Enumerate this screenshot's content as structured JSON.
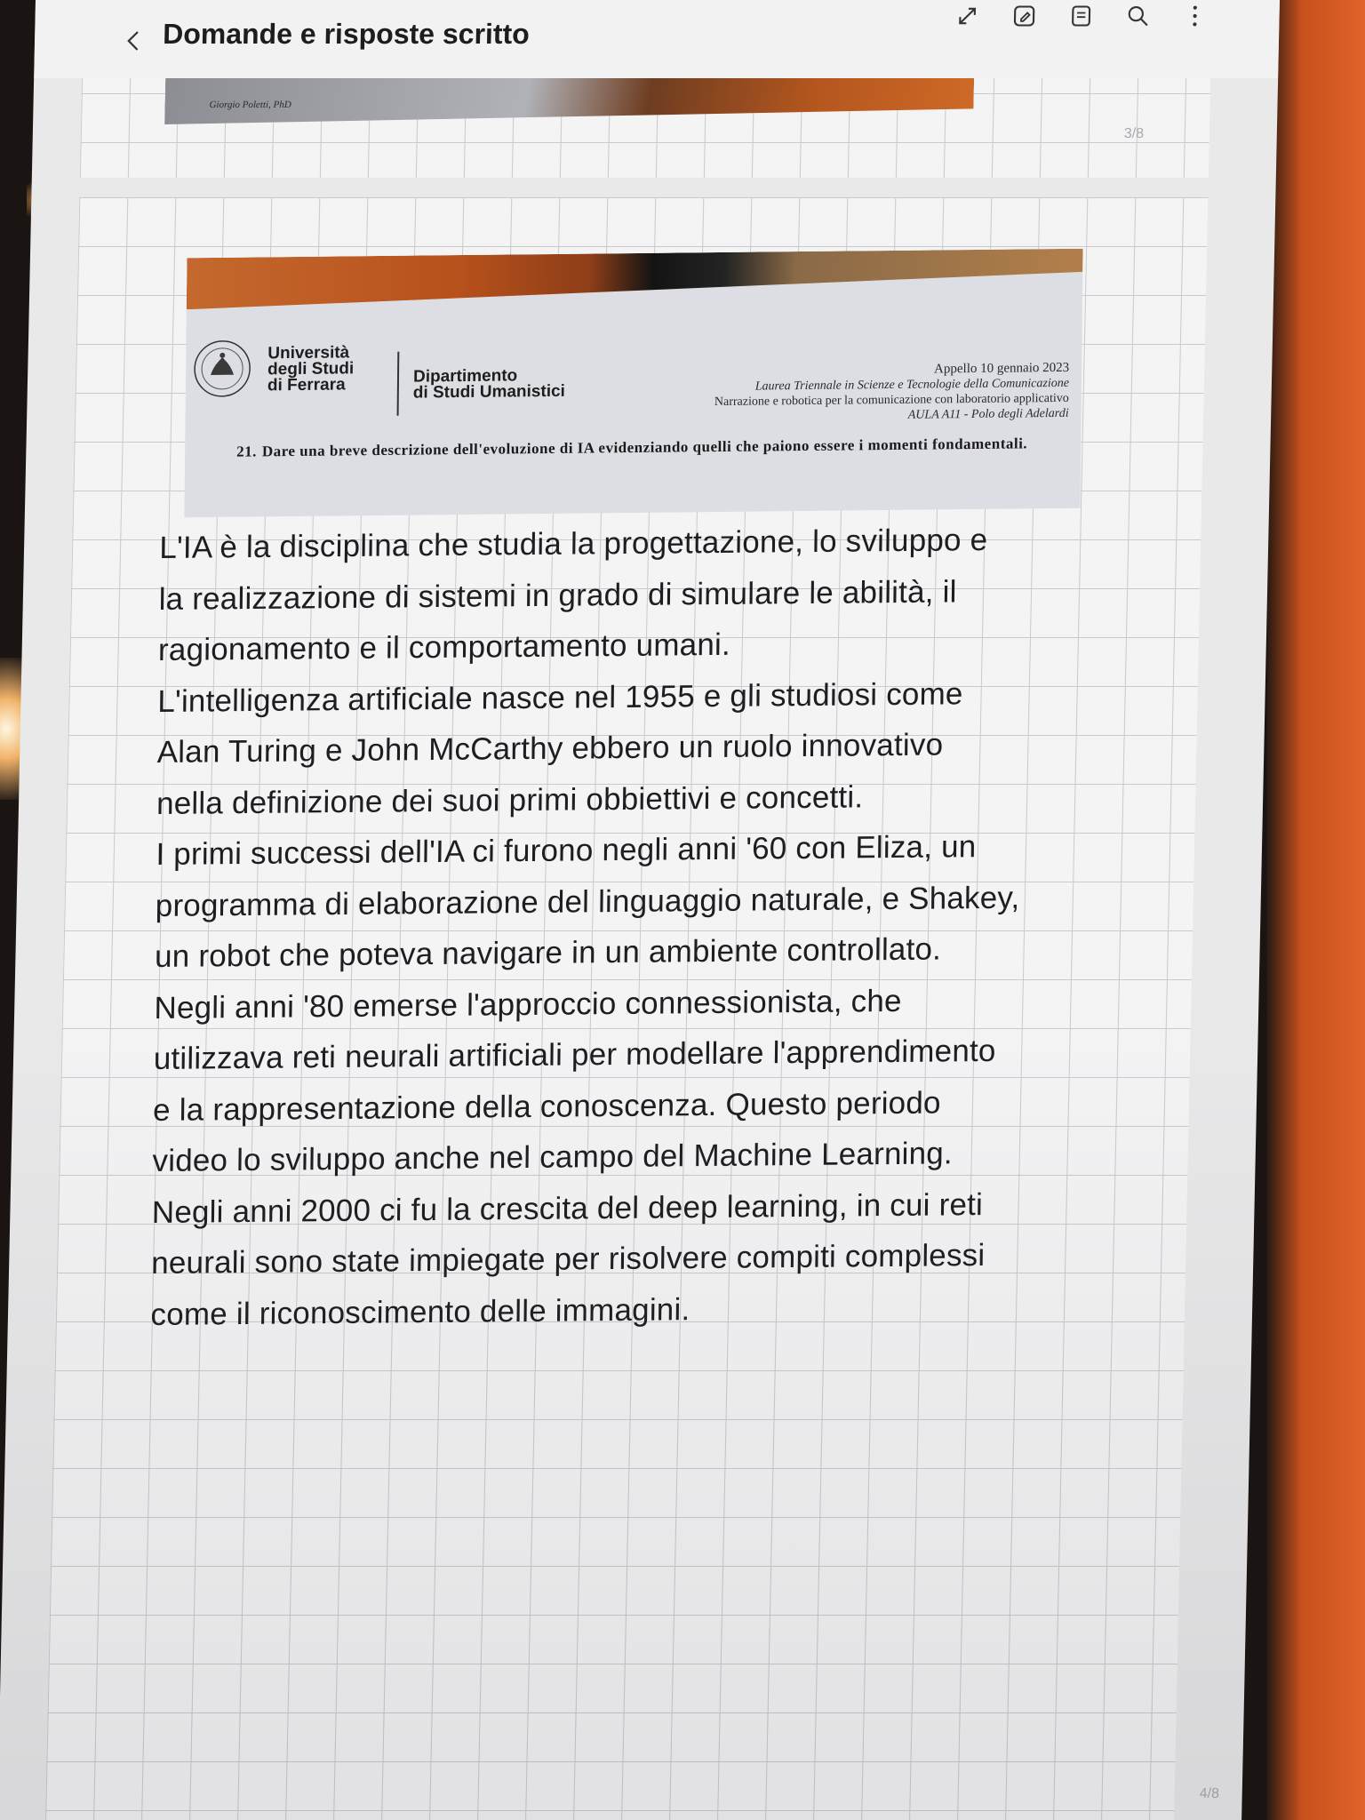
{
  "app": {
    "title": "Domande e risposte scritto"
  },
  "toolbar": {
    "icons": [
      "expand-icon",
      "pen-edit-icon",
      "read-mode-icon",
      "search-icon",
      "more-options-icon"
    ]
  },
  "previous_page": {
    "author": "Giorgio Poletti, PhD",
    "page_number": "3/8"
  },
  "exam_header": {
    "university": [
      "Università",
      "degli Studi",
      "di Ferrara"
    ],
    "department": [
      "Dipartimento",
      "di Studi Umanistici"
    ],
    "appello": "Appello 10 gennaio 2023",
    "laurea": "Laurea Triennale in Scienze e Tecnologie della Comunicazione",
    "course": "Narrazione e robotica per la comunicazione con laboratorio applicativo",
    "aula": "AULA A11 - Polo degli Adelardi",
    "question_number": "21.",
    "question_text": "Dare una breve descrizione dell'evoluzione di IA evidenziando quelli che paiono essere i momenti fondamentali."
  },
  "answer_lines": [
    "L'IA è la disciplina che studia la progettazione, lo sviluppo e",
    "la realizzazione di sistemi in grado di simulare le abilità, il",
    "ragionamento e il comportamento umani.",
    "L'intelligenza artificiale nasce nel 1955 e gli studiosi come",
    "Alan Turing e John McCarthy ebbero un ruolo innovativo",
    "nella definizione dei suoi primi obbiettivi e concetti.",
    "I primi successi dell'IA ci furono negli anni '60 con Eliza, un",
    "programma di elaborazione del linguaggio naturale, e Shakey,",
    "un robot che poteva navigare in un ambiente controllato.",
    "Negli anni '80 emerse l'approccio connessionista, che",
    "utilizzava reti neurali artificiali per modellare l'apprendimento",
    "e la rappresentazione della conoscenza. Questo periodo",
    "video lo sviluppo anche nel campo del Machine Learning.",
    "Negli anni 2000 ci fu la crescita del deep learning, in cui reti",
    "neurali sono state impiegate per risolvere compiti complessi",
    "come il riconoscimento delle immagini."
  ],
  "current_page": {
    "page_number": "4/8"
  }
}
